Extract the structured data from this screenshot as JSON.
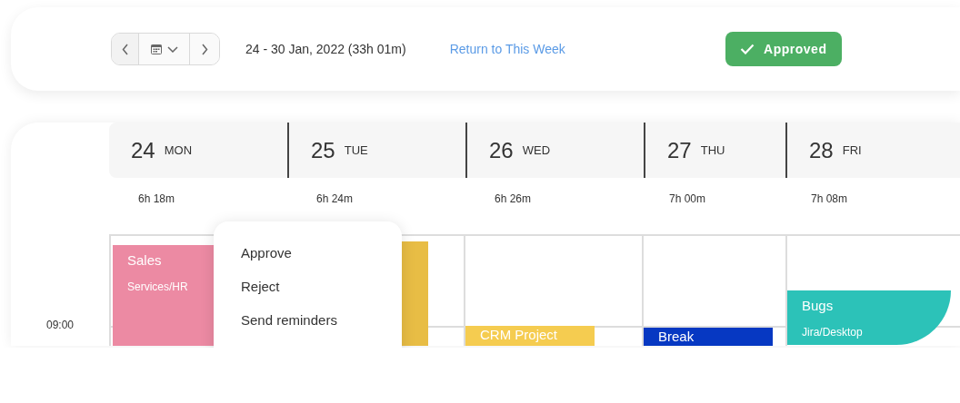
{
  "toolbar": {
    "date_range": "24 - 30 Jan, 2022 (33h 01m)",
    "return_link": "Return to This Week",
    "status": {
      "label": "Approved",
      "approved": true
    }
  },
  "days": [
    {
      "date": "24",
      "weekday": "MON",
      "total": "6h 18m"
    },
    {
      "date": "25",
      "weekday": "TUE",
      "total": "6h 24m"
    },
    {
      "date": "26",
      "weekday": "WED",
      "total": "6h 26m"
    },
    {
      "date": "27",
      "weekday": "THU",
      "total": "7h 00m"
    },
    {
      "date": "28",
      "weekday": "FRI",
      "total": "7h 08m"
    }
  ],
  "time_labels": [
    "09:00"
  ],
  "events": [
    {
      "title": "Sales",
      "subtitle": "Services/HR",
      "color": "#ec8aa3"
    },
    {
      "color": "#e8bd45"
    },
    {
      "title": "CRM Project",
      "color": "#f5cc50"
    },
    {
      "title": "Break",
      "color": "#0638c2"
    },
    {
      "title": "Bugs",
      "subtitle": "Jira/Desktop",
      "color": "#2cc2b8"
    }
  ],
  "menu": {
    "items": [
      "Approve",
      "Reject",
      "Send reminders"
    ]
  }
}
